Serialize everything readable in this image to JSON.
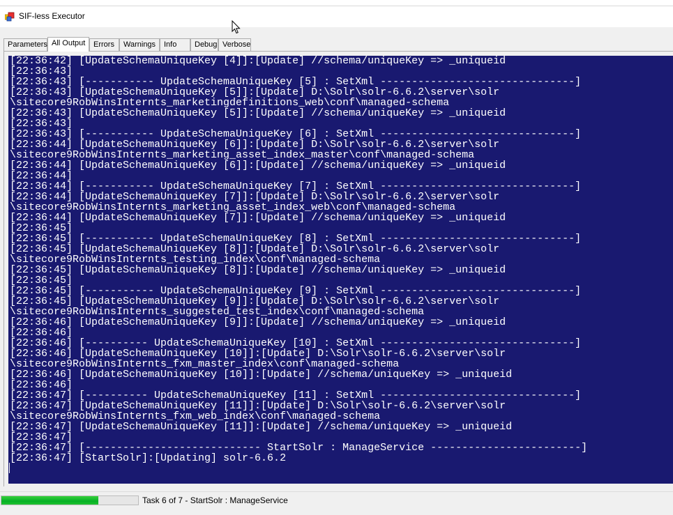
{
  "window": {
    "title": "SIF-less Executor",
    "icon": "application-icon"
  },
  "tabs": [
    {
      "label": "Parameters",
      "active": false
    },
    {
      "label": "All Output",
      "active": true
    },
    {
      "label": "Errors",
      "active": false
    },
    {
      "label": "Warnings",
      "active": false
    },
    {
      "label": "Info",
      "active": false
    },
    {
      "label": "Debug",
      "active": false
    },
    {
      "label": "Verbose",
      "active": false
    }
  ],
  "console": {
    "background": "#191970",
    "foreground": "#ffffff",
    "lines": [
      "[22:36:42] [UpdateSchemaUniqueKey [4]]:[Update] //schema/uniqueKey => _uniqueid",
      "[22:36:43]",
      "[22:36:43] [----------- UpdateSchemaUniqueKey [5] : SetXml -------------------------------]",
      "[22:36:43] [UpdateSchemaUniqueKey [5]]:[Update] D:\\Solr\\solr-6.6.2\\server\\solr",
      "\\sitecore9RobWinsInternts_marketingdefinitions_web\\conf\\managed-schema",
      "[22:36:43] [UpdateSchemaUniqueKey [5]]:[Update] //schema/uniqueKey => _uniqueid",
      "[22:36:43]",
      "[22:36:43] [----------- UpdateSchemaUniqueKey [6] : SetXml -------------------------------]",
      "[22:36:44] [UpdateSchemaUniqueKey [6]]:[Update] D:\\Solr\\solr-6.6.2\\server\\solr",
      "\\sitecore9RobWinsInternts_marketing_asset_index_master\\conf\\managed-schema",
      "[22:36:44] [UpdateSchemaUniqueKey [6]]:[Update] //schema/uniqueKey => _uniqueid",
      "[22:36:44]",
      "[22:36:44] [----------- UpdateSchemaUniqueKey [7] : SetXml -------------------------------]",
      "[22:36:44] [UpdateSchemaUniqueKey [7]]:[Update] D:\\Solr\\solr-6.6.2\\server\\solr",
      "\\sitecore9RobWinsInternts_marketing_asset_index_web\\conf\\managed-schema",
      "[22:36:44] [UpdateSchemaUniqueKey [7]]:[Update] //schema/uniqueKey => _uniqueid",
      "[22:36:45]",
      "[22:36:45] [----------- UpdateSchemaUniqueKey [8] : SetXml -------------------------------]",
      "[22:36:45] [UpdateSchemaUniqueKey [8]]:[Update] D:\\Solr\\solr-6.6.2\\server\\solr",
      "\\sitecore9RobWinsInternts_testing_index\\conf\\managed-schema",
      "[22:36:45] [UpdateSchemaUniqueKey [8]]:[Update] //schema/uniqueKey => _uniqueid",
      "[22:36:45]",
      "[22:36:45] [----------- UpdateSchemaUniqueKey [9] : SetXml -------------------------------]",
      "[22:36:45] [UpdateSchemaUniqueKey [9]]:[Update] D:\\Solr\\solr-6.6.2\\server\\solr",
      "\\sitecore9RobWinsInternts_suggested_test_index\\conf\\managed-schema",
      "[22:36:46] [UpdateSchemaUniqueKey [9]]:[Update] //schema/uniqueKey => _uniqueid",
      "[22:36:46]",
      "[22:36:46] [---------- UpdateSchemaUniqueKey [10] : SetXml -------------------------------]",
      "[22:36:46] [UpdateSchemaUniqueKey [10]]:[Update] D:\\Solr\\solr-6.6.2\\server\\solr",
      "\\sitecore9RobWinsInternts_fxm_master_index\\conf\\managed-schema",
      "[22:36:46] [UpdateSchemaUniqueKey [10]]:[Update] //schema/uniqueKey => _uniqueid",
      "[22:36:46]",
      "[22:36:47] [---------- UpdateSchemaUniqueKey [11] : SetXml -------------------------------]",
      "[22:36:47] [UpdateSchemaUniqueKey [11]]:[Update] D:\\Solr\\solr-6.6.2\\server\\solr",
      "\\sitecore9RobWinsInternts_fxm_web_index\\conf\\managed-schema",
      "[22:36:47] [UpdateSchemaUniqueKey [11]]:[Update] //schema/uniqueKey => _uniqueid",
      "[22:36:47]",
      "[22:36:47] [---------------------------- StartSolr : ManageService ------------------------]",
      "[22:36:47] [StartSolr]:[Updating] solr-6.6.2"
    ]
  },
  "status": {
    "progress_fraction": 0.71,
    "progress_color": "#06b025",
    "text": "Task 6 of 7 - StartSolr : ManageService"
  }
}
